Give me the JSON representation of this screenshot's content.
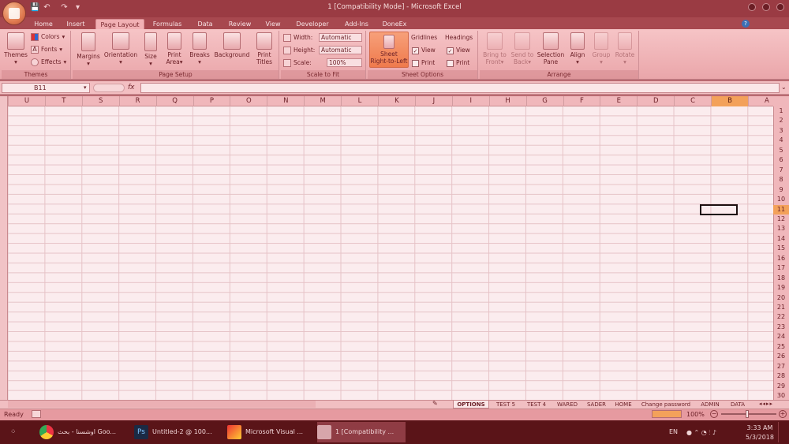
{
  "window": {
    "title": "1  [Compatibility Mode] - Microsoft Excel"
  },
  "quick_access": {
    "save": "💾",
    "undo": "↶",
    "redo": "↷",
    "more": "▾"
  },
  "tabs": [
    "Home",
    "Insert",
    "Page Layout",
    "Formulas",
    "Data",
    "Review",
    "View",
    "Developer",
    "Add-Ins",
    "DoneEx"
  ],
  "active_tab": "Page Layout",
  "ribbon": {
    "themes_group": {
      "label": "Themes",
      "themes": "Themes",
      "colors": "Colors",
      "fonts": "Fonts",
      "effects": "Effects"
    },
    "page_setup_group": {
      "label": "Page Setup",
      "margins": "Margins",
      "orientation": "Orientation",
      "size": "Size",
      "print_area_1": "Print",
      "print_area_2": "Area",
      "breaks": "Breaks",
      "background": "Background",
      "print_titles_1": "Print",
      "print_titles_2": "Titles"
    },
    "scale_group": {
      "label": "Scale to Fit",
      "width_label": "Width:",
      "width_value": "Automatic",
      "height_label": "Height:",
      "height_value": "Automatic",
      "scale_label": "Scale:",
      "scale_value": "100%"
    },
    "sheet_options_group": {
      "label": "Sheet Options",
      "sheet_rtl_1": "Sheet",
      "sheet_rtl_2": "Right-to-Left",
      "gridlines": "Gridlines",
      "headings": "Headings",
      "view": "View",
      "print": "Print"
    },
    "arrange_group": {
      "label": "Arrange",
      "bring_front_1": "Bring to",
      "bring_front_2": "Front",
      "send_back_1": "Send to",
      "send_back_2": "Back",
      "selection_1": "Selection",
      "selection_2": "Pane",
      "align": "Align",
      "group": "Group",
      "rotate": "Rotate"
    }
  },
  "formula_bar": {
    "name_box": "B11",
    "fx": "fx",
    "formula": ""
  },
  "columns": [
    "U",
    "T",
    "S",
    "R",
    "Q",
    "P",
    "O",
    "N",
    "M",
    "L",
    "K",
    "J",
    "I",
    "H",
    "G",
    "F",
    "E",
    "D",
    "C",
    "B",
    "A"
  ],
  "selected_column": "B",
  "rows": [
    "1",
    "2",
    "3",
    "4",
    "5",
    "6",
    "7",
    "8",
    "9",
    "10",
    "11",
    "12",
    "13",
    "14",
    "15",
    "16",
    "17",
    "18",
    "19",
    "20",
    "21",
    "22",
    "23",
    "24",
    "25",
    "26",
    "27",
    "28",
    "29",
    "30"
  ],
  "selected_row": "11",
  "sheet_tabs": [
    "OPTIONS",
    "TEST 5",
    "TEST 4",
    "WARED",
    "SADER",
    "HOME",
    "Change password",
    "ADMIN",
    "DATA"
  ],
  "active_sheet": "OPTIONS",
  "status": {
    "mode": "Ready",
    "zoom": "100%"
  },
  "taskbar": {
    "items": [
      "اوشسنا - بحث Goo...",
      "Untitled-2 @ 100...",
      "Microsoft Visual ...",
      "1  [Compatibility ..."
    ],
    "lang": "EN",
    "time": "3:33 AM",
    "date": "5/3/2018"
  },
  "colors": {
    "accent": "#f3a15a",
    "titlebar": "#9a3b43",
    "ribbon": "#f6c4c6",
    "taskbar": "#5a1418"
  }
}
